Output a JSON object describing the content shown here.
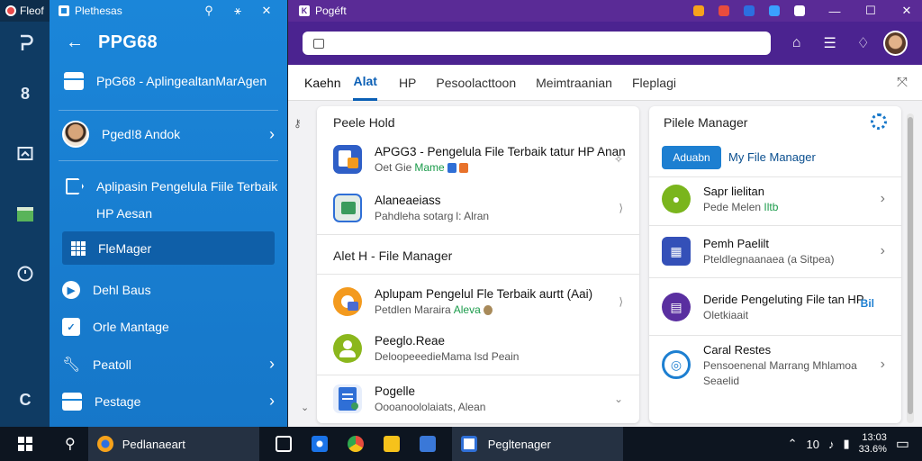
{
  "rail": {
    "title": "Fleof"
  },
  "panel": {
    "window_title": "Plethesas",
    "title": "PPG68",
    "subtitle": "PpG68 - AplingealtanMarAgen",
    "profile_label": "Pged!8 Andok",
    "multi_line_1": "Aplipasin Pengelula Fiile Terbaik",
    "multi_line_2": "HP Aesan",
    "active_label": "FleMager",
    "items": [
      {
        "label": "Dehl Baus"
      },
      {
        "label": "Orle Mantage"
      },
      {
        "label": "Peatoll"
      },
      {
        "label": "Pestage"
      }
    ]
  },
  "window": {
    "title": "Pogéft",
    "tabs": [
      {
        "label": "Kaehn"
      },
      {
        "label": "Alat"
      },
      {
        "label": "HP"
      },
      {
        "label": "Pesoolacttoon"
      },
      {
        "label": "Meimtraanian"
      },
      {
        "label": "Fleplagi"
      }
    ]
  },
  "left_card": {
    "header": "Peele Hold",
    "rows": [
      {
        "title": "APGG3 - Pengelula File Terbaik tatur HP Anan",
        "sub_a": "Oet Gie",
        "sub_b": "Mame",
        "icon_color": "#2f5fc7"
      },
      {
        "title": "Alaneaeiass",
        "sub_a": "Pahdleha sotarg",
        "sub_b": "l: Alran",
        "icon_color": "#3a9b5c"
      }
    ],
    "section2": "Alet H - File Manager",
    "rows2": [
      {
        "title": "Aplupam Pengelul Fle Terbaik aurtt (Aai)",
        "sub_a": "Petdlen Maraira",
        "sub_b": "Aleva",
        "icon_color": "#f39a1e"
      },
      {
        "title": "Peeglo.Reae",
        "sub_a": "DeloopeeedieMama",
        "sub_b": "Isd Peain",
        "icon_color": "#8bb71d"
      },
      {
        "title": "Pogelle",
        "sub_a": "Oooanoololaiats, Alean",
        "sub_b": "",
        "icon_color": "#2f6fd6"
      }
    ]
  },
  "right_card": {
    "header": "Pilele Manager",
    "chip": "Aduabn",
    "chip_label": "My File Manager",
    "rows": [
      {
        "title": "Sapr lielitan",
        "sub_a": "Pede Melen",
        "sub_b": "Iltb",
        "color": "#7ab51d",
        "glyph": "●"
      },
      {
        "title": "Pemh Paelilt",
        "sub_a": "Pteldlegnaanaea (a Sitpea)",
        "sub_b": "",
        "color": "#3450b8",
        "glyph": "▦"
      },
      {
        "title": "Deride Pengeluting File tan HP",
        "sub_a": "Oletkiaait",
        "sub_b": "",
        "color": "#5a2fa0",
        "glyph": "▤",
        "badge": "Bil"
      },
      {
        "title": "Caral Restes",
        "sub_a": "Pensoenenal Marrang Mhlamoa",
        "sub_b": "Seaelid",
        "color": "#1d7fd1",
        "glyph": "◎"
      }
    ]
  },
  "taskbar": {
    "app1": "Pedlanaeart",
    "app2": "Pegltenager",
    "tray_text": "10",
    "time": "13:03",
    "date": "33.6%"
  }
}
